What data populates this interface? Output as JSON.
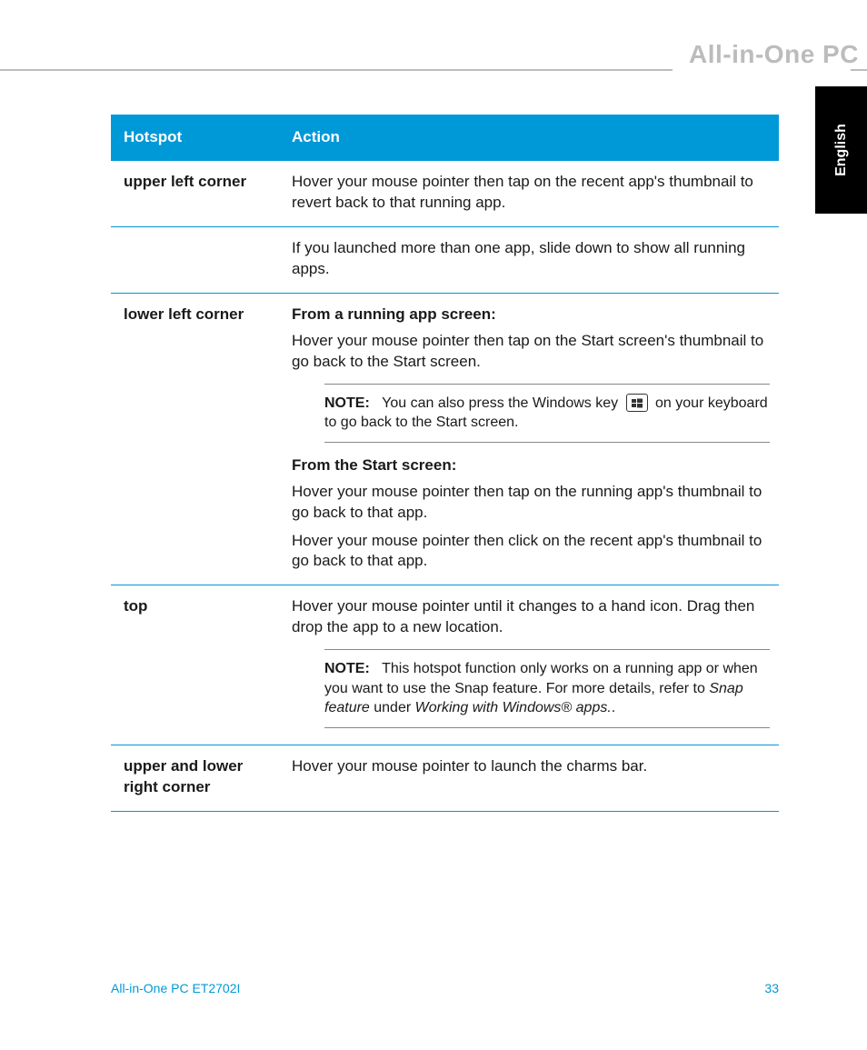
{
  "brand": "All-in-One PC",
  "language_tab": "English",
  "table": {
    "headers": {
      "hotspot": "Hotspot",
      "action": "Action"
    },
    "rows": {
      "r1_hotspot": "upper left corner",
      "r1_action": "Hover your mouse pointer then tap on the recent app's thumbnail to revert back to that running app.",
      "r2_action": "If you launched more than one app, slide down to show all running apps.",
      "r3_hotspot": "lower left corner",
      "r3_sub1": "From a running app screen:",
      "r3_p1": "Hover your mouse pointer then tap on the Start screen's thumbnail to go back to the Start screen.",
      "r3_note_label": "NOTE:",
      "r3_note_a": "You can also press the Windows key",
      "r3_note_b": "on your keyboard to go back to the Start screen.",
      "r3_sub2": "From the Start screen:",
      "r3_p2": "Hover your mouse pointer then tap on the running app's thumbnail to go back to that app.",
      "r3_p3": "Hover your mouse pointer then click on the recent app's thumbnail to go back to that app.",
      "r4_hotspot": "top",
      "r4_p1": "Hover your mouse pointer until it changes to a hand icon. Drag then drop the app to a new location.",
      "r4_note_label": "NOTE:",
      "r4_note_a": "This hotspot function only works on a running app or when you want to use the Snap feature. For more details, refer to ",
      "r4_note_i1": "Snap feature",
      "r4_note_b": " under ",
      "r4_note_i2": "Working with Windows® apps.",
      "r4_note_c": ".",
      "r5_hotspot": "upper and lower right corner",
      "r5_action": "Hover your mouse pointer to launch the charms bar."
    }
  },
  "footer": {
    "model": "All-in-One PC ET2702I",
    "page": "33"
  }
}
